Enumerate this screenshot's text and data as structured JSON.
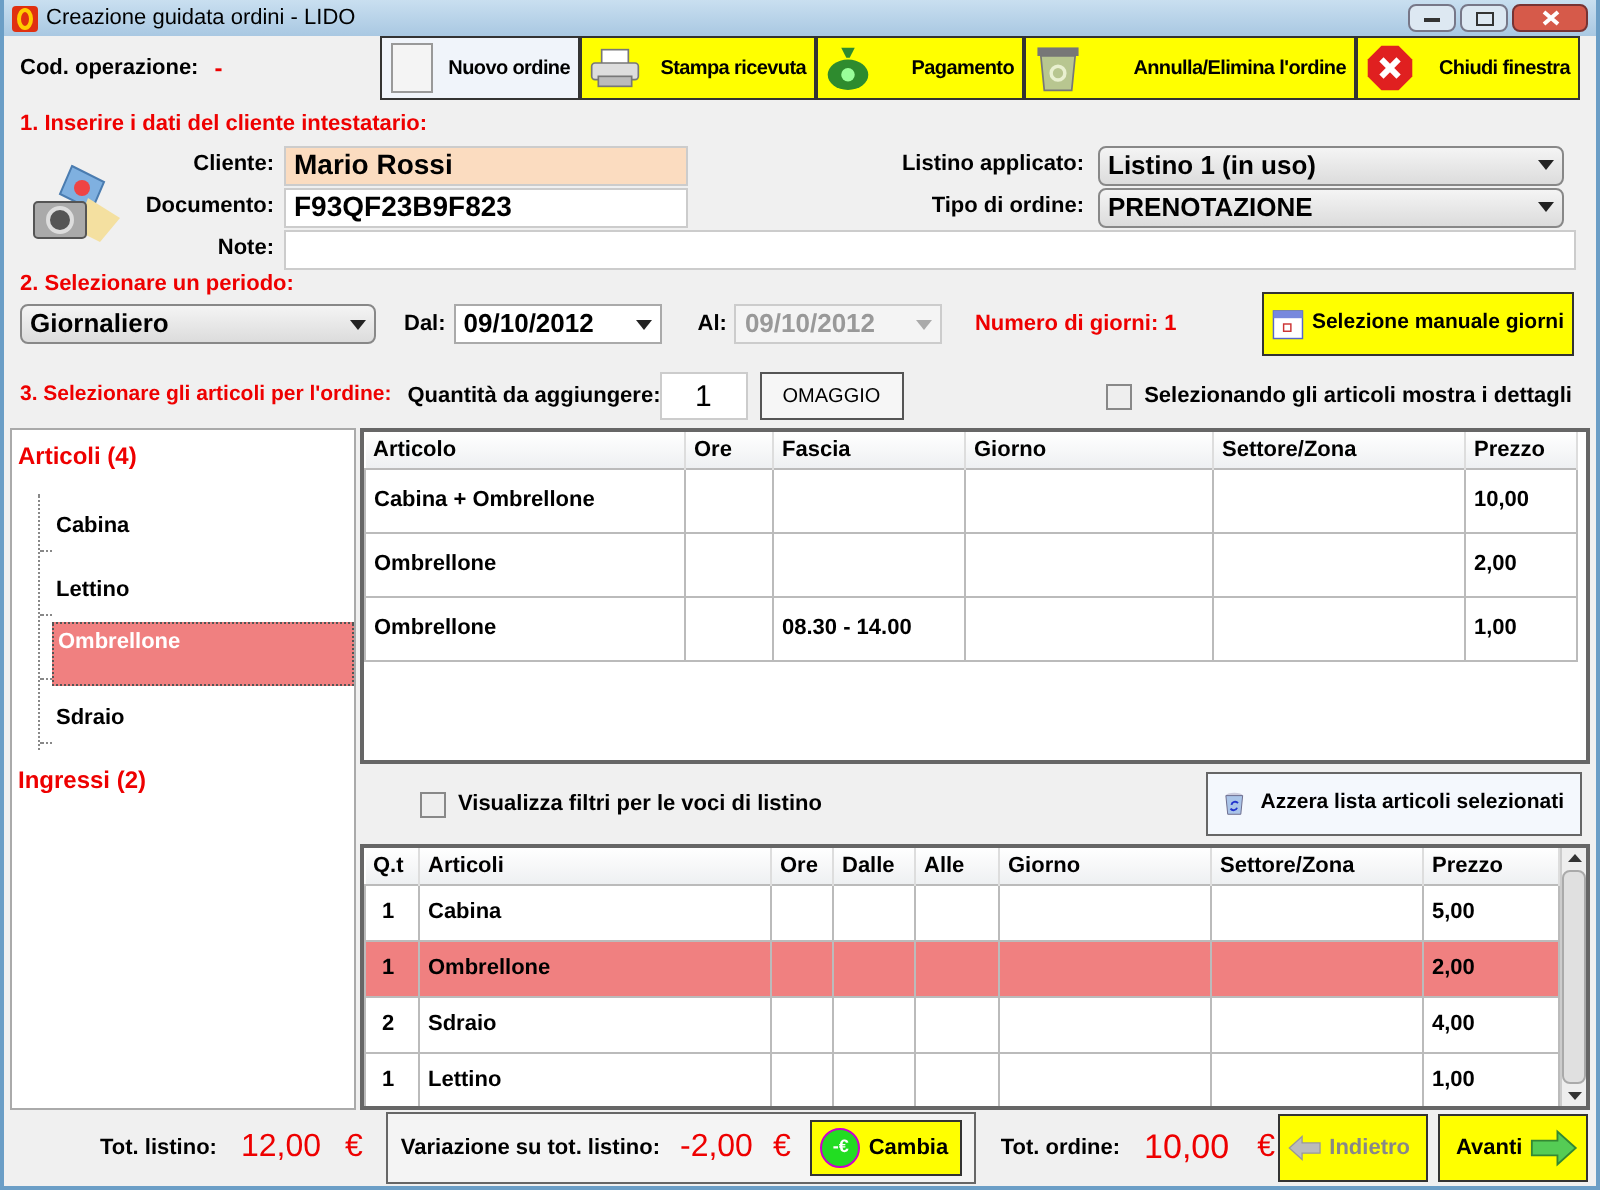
{
  "window": {
    "title": "Creazione guidata ordini - LIDO"
  },
  "operation": {
    "label": "Cod. operazione:",
    "value": "-"
  },
  "toolbar": [
    {
      "label": "Nuovo ordine",
      "selected": true,
      "kind": "new"
    },
    {
      "label": "Stampa ricevuta",
      "selected": false,
      "kind": "print"
    },
    {
      "label": "Pagamento",
      "selected": false,
      "kind": "pay"
    },
    {
      "label": "Annulla/Elimina l'ordine",
      "selected": false,
      "kind": "delete"
    },
    {
      "label": "Chiudi finestra",
      "selected": false,
      "kind": "close"
    }
  ],
  "step1": {
    "heading": "1. Inserire i dati del cliente intestatario:",
    "client": {
      "label": "Cliente:",
      "value": "Mario Rossi",
      "focused": true
    },
    "document": {
      "label": "Documento:",
      "value": "F93QF23B9F823",
      "focused": false
    },
    "note": {
      "label": "Note:"
    },
    "price_list": {
      "label": "Listino applicato:",
      "value": "Listino 1 (in uso)"
    },
    "order_type": {
      "label": "Tipo di ordine:",
      "value": "PRENOTAZIONE"
    }
  },
  "step2": {
    "heading": "2. Selezionare un periodo:",
    "period": "Giornaliero",
    "from": {
      "label": "Dal:",
      "value": "09/10/2012",
      "disabled": false
    },
    "to": {
      "label": "Al:",
      "value": "09/10/2012",
      "disabled": true
    },
    "days": "Numero di giorni: 1",
    "manual_button": "Selezione manuale giorni"
  },
  "step3": {
    "heading": "3. Selezionare gli articoli per l'ordine:",
    "quantity_label": "Quantità da aggiungere:",
    "quantity": "1",
    "gift_button": "OMAGGIO",
    "details_checkbox": {
      "label": "Selezionando gli articoli mostra i dettagli",
      "checked": false
    }
  },
  "tree": [
    {
      "label": "Articoli (4)",
      "children": [
        {
          "label": "Cabina",
          "selected": false
        },
        {
          "label": "Lettino",
          "selected": false
        },
        {
          "label": "Ombrellone",
          "selected": true
        },
        {
          "label": "Sdraio",
          "selected": false
        }
      ]
    },
    {
      "label": "Ingressi (2)"
    }
  ],
  "price_table": {
    "columns": [
      "Articolo",
      "Ore",
      "Fascia",
      "Giorno",
      "Settore/Zona",
      "Prezzo"
    ],
    "rows": [
      [
        "Cabina + Ombrellone",
        "",
        "",
        "",
        "",
        "10,00"
      ],
      [
        "Ombrellone",
        "",
        "",
        "",
        "",
        "2,00"
      ],
      [
        "Ombrellone",
        "",
        "08.30 - 14.00",
        "",
        "",
        "1,00"
      ]
    ]
  },
  "filter_checkbox": {
    "label": "Visualizza filtri per le voci di listino",
    "checked": false
  },
  "clear_button": "Azzera lista articoli selezionati",
  "selected_table": {
    "columns": [
      "Q.t",
      "Articoli",
      "Ore",
      "Dalle",
      "Alle",
      "Giorno",
      "Settore/Zona",
      "Prezzo"
    ],
    "rows": [
      {
        "cells": [
          "1",
          "Cabina",
          "",
          "",
          "",
          "",
          "",
          "5,00"
        ],
        "selected": false
      },
      {
        "cells": [
          "1",
          "Ombrellone",
          "",
          "",
          "",
          "",
          "",
          "2,00"
        ],
        "selected": true
      },
      {
        "cells": [
          "2",
          "Sdraio",
          "",
          "",
          "",
          "",
          "",
          "4,00"
        ],
        "selected": false
      },
      {
        "cells": [
          "1",
          "Lettino",
          "",
          "",
          "",
          "",
          "",
          "1,00"
        ],
        "selected": false
      }
    ]
  },
  "footer": {
    "list_total": {
      "label": "Tot. listino:",
      "value": "12,00",
      "currency": "€"
    },
    "variation": {
      "label": "Variazione su tot. listino:",
      "value": "-2,00",
      "currency": "€"
    },
    "change_button": {
      "label": "Cambia",
      "icon_text": "-€"
    },
    "order_total": {
      "label": "Tot. ordine:",
      "value": "10,00",
      "currency": "€"
    },
    "nav": [
      {
        "label": "Indietro",
        "disabled": true,
        "kind": "back"
      },
      {
        "label": "Avanti",
        "disabled": false,
        "kind": "next"
      }
    ]
  }
}
